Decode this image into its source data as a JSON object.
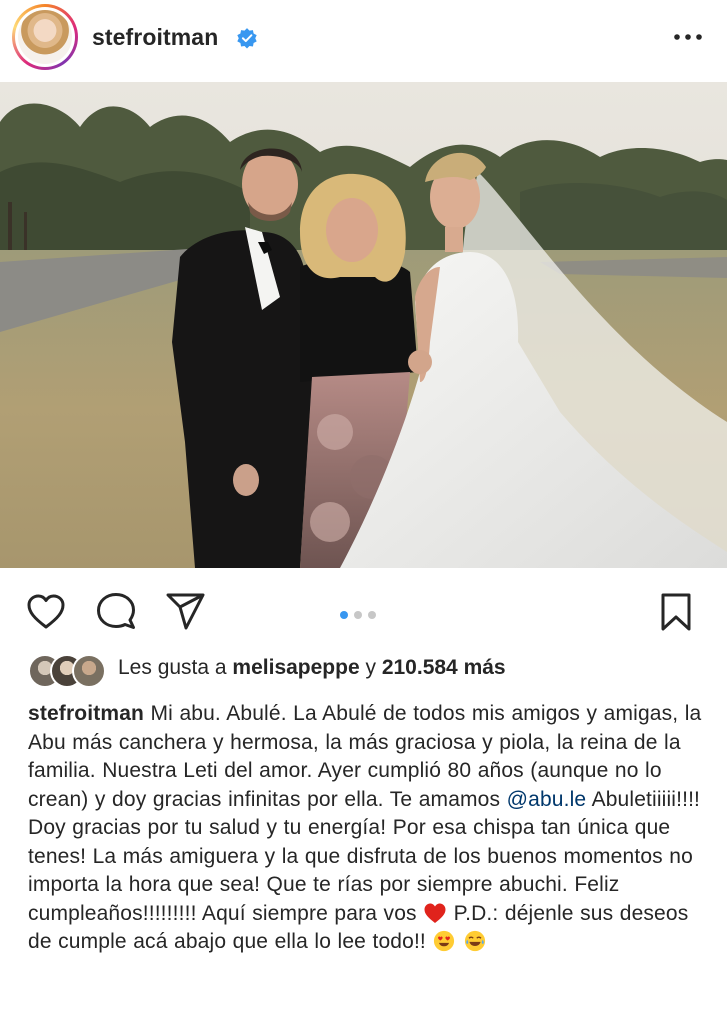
{
  "post": {
    "username": "stefroitman",
    "verified_icon": "verified-badge-icon",
    "more_icon": "more-options-icon",
    "image_alt": "Wedding photo: groom, grandmother and bride outdoors"
  },
  "carousel": {
    "total": 3,
    "active_index": 0
  },
  "actions": {
    "like_icon": "heart-icon",
    "comment_icon": "comment-icon",
    "share_icon": "share-icon",
    "save_icon": "bookmark-icon"
  },
  "likes": {
    "prefix": "Les gusta a ",
    "user": "melisapeppe",
    "connector": " y ",
    "count": "210.584 más"
  },
  "caption": {
    "author": "stefroitman",
    "part1": " Mi abu. Abulé. La Abulé de todos mis amigos y amigas, la Abu más canchera y hermosa, la más graciosa y piola, la reina de la familia. Nuestra Leti del amor. Ayer cumplió 80 años (aunque no lo crean) y doy gracias infinitas por ella. Te amamos ",
    "mention": "@abu.le",
    "part2": " Abuletiiiii!!!! Doy gracias por tu salud y tu energía! Por esa chispa tan única que tenes! La más amiguera y la que disfruta de los buenos momentos no importa la hora que sea! Que te rías por siempre abuchi. Feliz cumpleaños!!!!!!!!! Aquí siempre para vos ",
    "part3": " P.D.: déjenle sus deseos de cumple acá abajo que ella lo lee todo!! ",
    "emoji_heart": "red-heart-emoji",
    "emoji_love": "heart-eyes-emoji",
    "emoji_laugh": "tears-of-joy-emoji"
  },
  "colors": {
    "verified_blue": "#3897f0",
    "mention_blue": "#00376b",
    "text": "#262626",
    "dot_active": "#3897f0",
    "dot_inactive": "#c7c7c7"
  }
}
